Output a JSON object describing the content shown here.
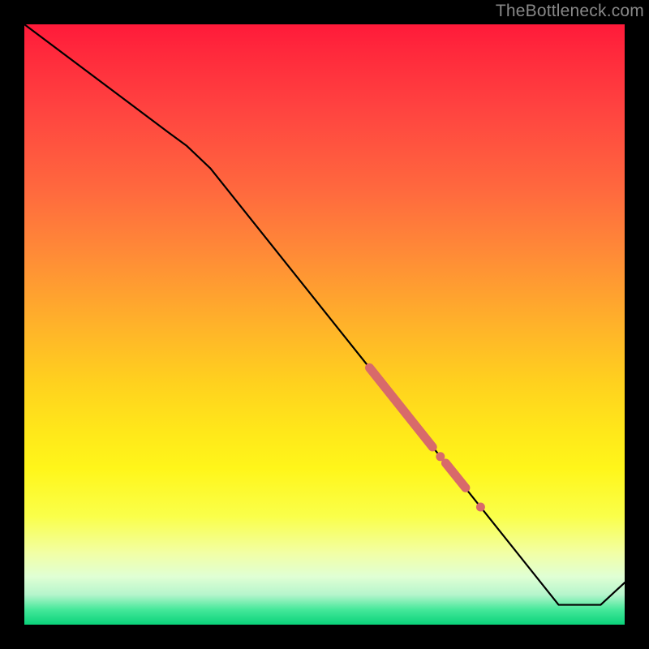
{
  "watermark": "TheBottleneck.com",
  "chart_data": {
    "type": "line",
    "title": "",
    "xlabel": "",
    "ylabel": "",
    "x_range": [
      0,
      100
    ],
    "y_range": [
      0,
      100
    ],
    "line_points_normalized": [
      {
        "x": 0.0,
        "y": 1.0
      },
      {
        "x": 0.24,
        "y": 0.82
      },
      {
        "x": 0.27,
        "y": 0.798
      },
      {
        "x": 0.31,
        "y": 0.76
      },
      {
        "x": 0.89,
        "y": 0.033
      },
      {
        "x": 0.96,
        "y": 0.033
      },
      {
        "x": 1.0,
        "y": 0.07
      }
    ],
    "highlight_segments_normalized": [
      {
        "x1": 0.575,
        "y1": 0.428,
        "x2": 0.68,
        "y2": 0.296
      },
      {
        "x1": 0.702,
        "y1": 0.269,
        "x2": 0.735,
        "y2": 0.228
      }
    ],
    "highlight_dots_normalized": [
      {
        "x": 0.693,
        "y": 0.28,
        "r": 5.5
      },
      {
        "x": 0.76,
        "y": 0.196,
        "r": 5.5
      }
    ],
    "colors": {
      "line": "#000000",
      "highlight": "#d86a6a",
      "gradient_top": "#ff1a3a",
      "gradient_bottom": "#0ad27a"
    }
  }
}
